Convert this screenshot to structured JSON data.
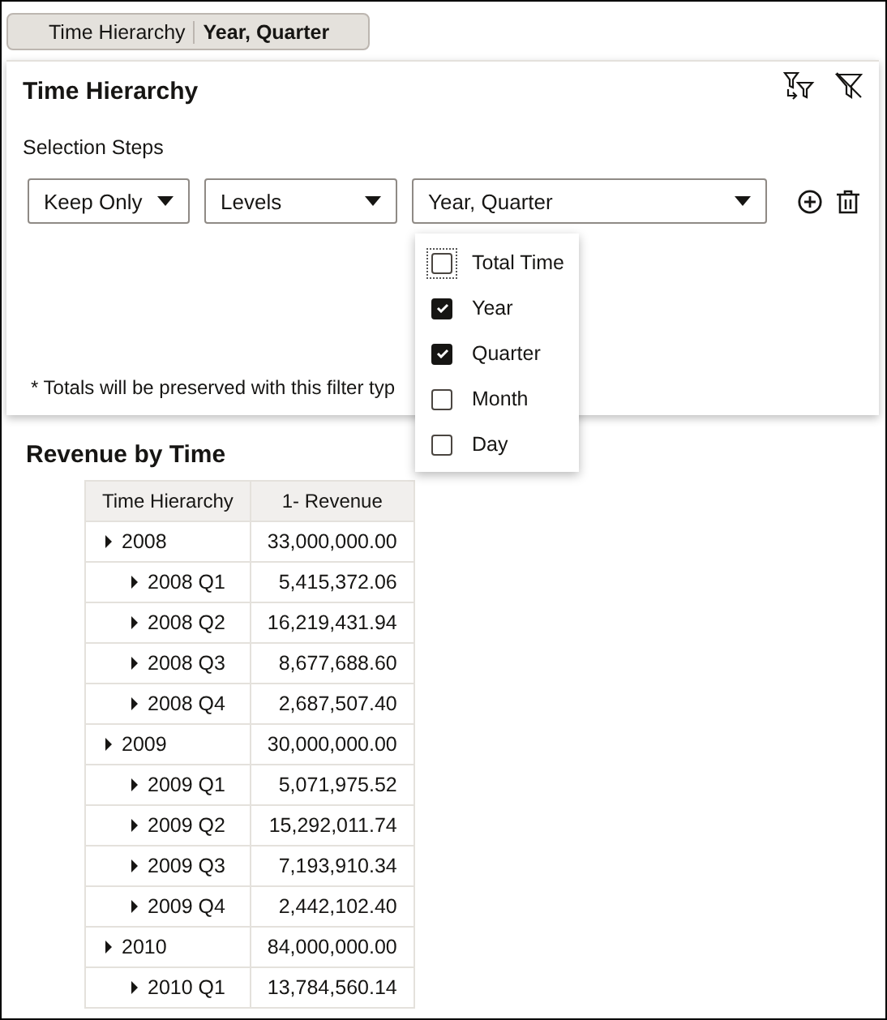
{
  "filter_pill": {
    "label": "Time Hierarchy",
    "value": "Year, Quarter"
  },
  "filter_panel": {
    "title": "Time Hierarchy",
    "section_label": "Selection Steps",
    "steps": [
      {
        "action": "Keep Only",
        "method": "Levels",
        "value": "Year, Quarter"
      }
    ],
    "footnote": "* Totals will be preserved with this filter typ"
  },
  "level_menu": [
    {
      "label": "Total Time",
      "checked": false,
      "focused": true
    },
    {
      "label": "Year",
      "checked": true,
      "focused": false
    },
    {
      "label": "Quarter",
      "checked": true,
      "focused": false
    },
    {
      "label": "Month",
      "checked": false,
      "focused": false
    },
    {
      "label": "Day",
      "checked": false,
      "focused": false
    }
  ],
  "table": {
    "title": "Revenue by Time",
    "columns": [
      "Time Hierarchy",
      "1- Revenue"
    ],
    "rows": [
      {
        "label": "2008",
        "value": "33,000,000.00",
        "children": [
          {
            "label": "2008 Q1",
            "value": "5,415,372.06"
          },
          {
            "label": "2008 Q2",
            "value": "16,219,431.94"
          },
          {
            "label": "2008 Q3",
            "value": "8,677,688.60"
          },
          {
            "label": "2008 Q4",
            "value": "2,687,507.40"
          }
        ]
      },
      {
        "label": "2009",
        "value": "30,000,000.00",
        "children": [
          {
            "label": "2009 Q1",
            "value": "5,071,975.52"
          },
          {
            "label": "2009 Q2",
            "value": "15,292,011.74"
          },
          {
            "label": "2009 Q3",
            "value": "7,193,910.34"
          },
          {
            "label": "2009 Q4",
            "value": "2,442,102.40"
          }
        ]
      },
      {
        "label": "2010",
        "value": "84,000,000.00",
        "children": [
          {
            "label": "2010 Q1",
            "value": "13,784,560.14"
          }
        ]
      }
    ]
  }
}
